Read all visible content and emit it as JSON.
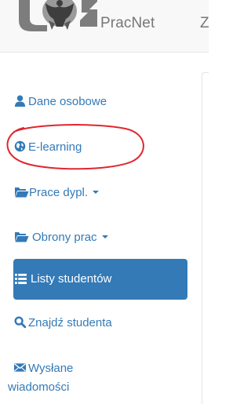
{
  "header": {
    "brand": "PracNet",
    "next_nav_fragment": "Z"
  },
  "sidebar": {
    "items": [
      {
        "label": "Dane osobowe",
        "icon": "user-icon"
      },
      {
        "label": "E-learning",
        "icon": "globe-icon",
        "highlighted": true
      },
      {
        "label": "Prace dypl.",
        "icon": "folder-open-icon",
        "dropdown": true
      },
      {
        "label": "Obrony prac",
        "icon": "folder-open-icon",
        "dropdown": true
      },
      {
        "label": "Listy studentów",
        "icon": "list-icon",
        "active": true
      },
      {
        "label": "Znajdź studenta",
        "icon": "search-icon"
      },
      {
        "label_line1": "Wysłane",
        "label_line2": "wiadomości",
        "icon": "envelope-icon"
      }
    ]
  },
  "colors": {
    "link": "#337ab7",
    "active_bg": "#337ab7",
    "annotation": "#e0262e"
  }
}
